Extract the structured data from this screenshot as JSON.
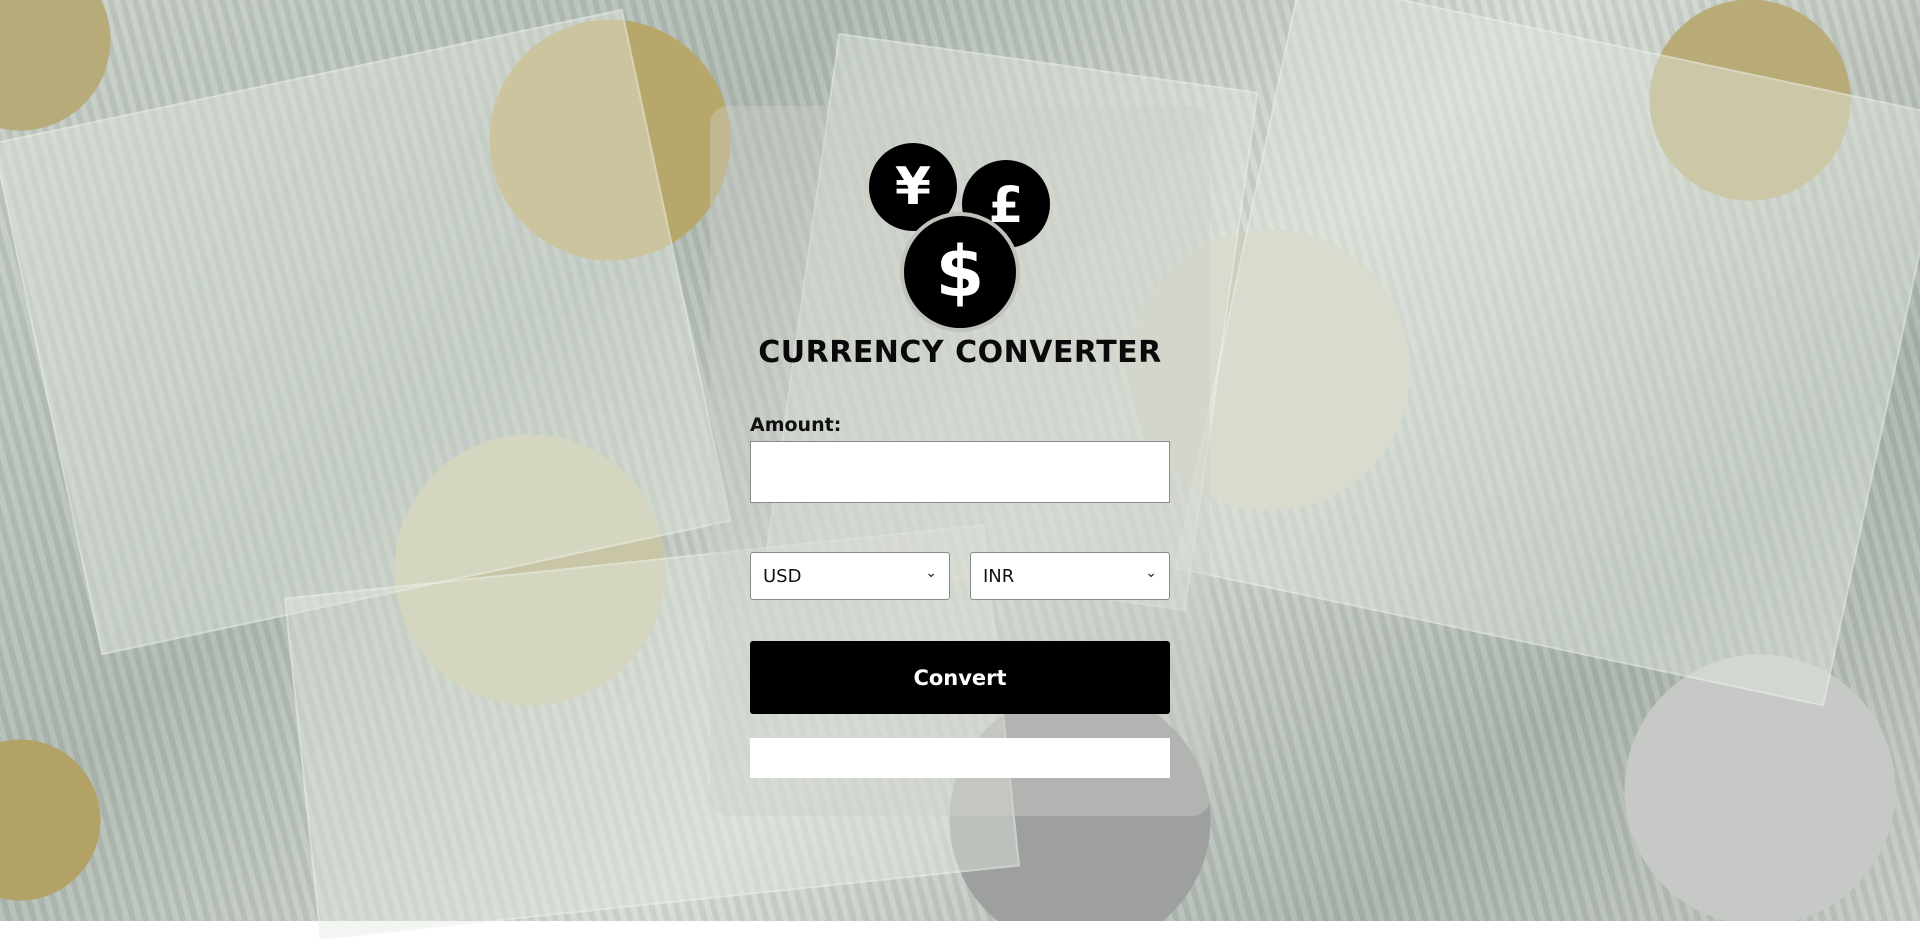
{
  "app": {
    "title": "CURRENCY CONVERTER",
    "logo_icon": "currency-coins-icon"
  },
  "form": {
    "amount_label": "Amount:",
    "amount_value": "",
    "amount_placeholder": "",
    "from_currency": "USD",
    "to_currency": "INR",
    "convert_label": "Convert",
    "result_text": ""
  },
  "colors": {
    "button_bg": "#000000",
    "button_text": "#ffffff",
    "title_text": "#0a0a0a"
  }
}
